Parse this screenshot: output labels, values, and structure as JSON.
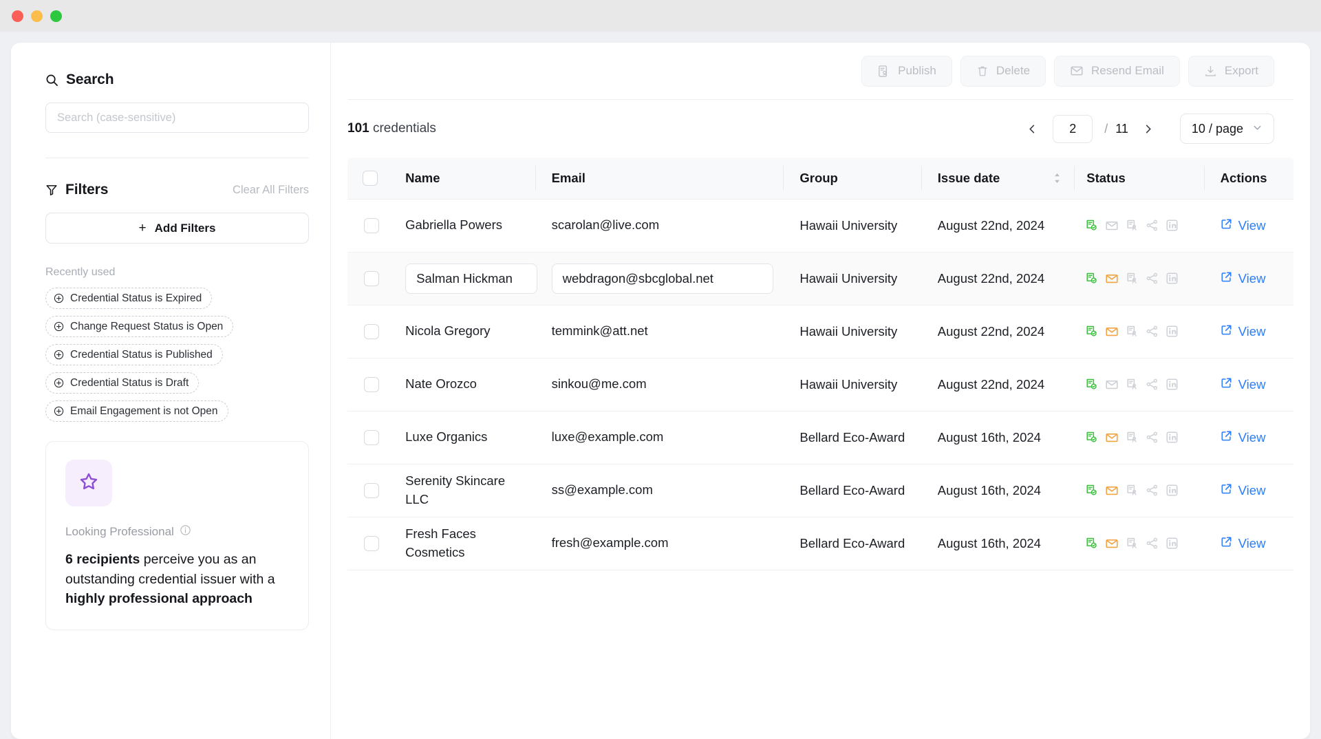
{
  "window": {
    "traffic_lights": [
      "close",
      "minimize",
      "maximize"
    ]
  },
  "sidebar": {
    "search": {
      "heading": "Search",
      "icon": "search-icon",
      "placeholder": "Search (case-sensitive)",
      "value": ""
    },
    "filters": {
      "heading": "Filters",
      "icon": "filter-icon",
      "clear_all_label": "Clear All Filters",
      "add_filters_label": "Add Filters",
      "add_filters_plus": "+",
      "recently_used_label": "Recently used",
      "recent_chips": [
        {
          "label": "Credential Status is Expired",
          "icon": "plus-circle-icon"
        },
        {
          "label": "Change Request Status is Open",
          "icon": "plus-circle-icon"
        },
        {
          "label": "Credential Status is Published",
          "icon": "plus-circle-icon"
        },
        {
          "label": "Credential Status is Draft",
          "icon": "plus-circle-icon"
        },
        {
          "label": "Email Engagement is not Open",
          "icon": "plus-circle-icon"
        }
      ]
    },
    "promo": {
      "icon": "star-icon",
      "icon_color": "#8b4dd6",
      "icon_bg": "#f6edfd",
      "title": "Looking Professional",
      "info_icon": "info-circle-icon",
      "body_parts": [
        {
          "text": "6 recipients",
          "bold": true
        },
        {
          "text": " perceive you as an outstanding credential issuer with a ",
          "bold": false
        },
        {
          "text": "highly professional approach",
          "bold": true
        }
      ]
    }
  },
  "toolbar": {
    "buttons": [
      {
        "label": "Publish",
        "icon": "publish-document-icon",
        "disabled": true
      },
      {
        "label": "Delete",
        "icon": "trash-icon",
        "disabled": true
      },
      {
        "label": "Resend Email",
        "icon": "envelope-icon",
        "disabled": true
      },
      {
        "label": "Export",
        "icon": "download-icon",
        "disabled": true
      }
    ]
  },
  "list_header": {
    "count": "101",
    "count_noun": "credentials",
    "pagination": {
      "prev_icon": "chevron-left-icon",
      "next_icon": "chevron-right-icon",
      "current_page": "2",
      "separator": "/",
      "total_pages": "11",
      "per_page_label": "10 / page",
      "per_page_caret": "chevron-down-icon"
    }
  },
  "table": {
    "select_all_checkbox": "unchecked",
    "columns": [
      {
        "label": "Name"
      },
      {
        "label": "Email"
      },
      {
        "label": "Group"
      },
      {
        "label": "Issue date",
        "sortable": true,
        "sort_icon": "sort-updown-icon"
      },
      {
        "label": "Status"
      },
      {
        "label": "Actions"
      }
    ],
    "rows": [
      {
        "checked": false,
        "editing": false,
        "active": false,
        "name": "Gabriella Powers",
        "email": "scarolan@live.com",
        "group": "Hawaii University",
        "issue_date": "August 22nd, 2024",
        "status_icons": [
          {
            "name": "credential-published-icon",
            "state": "active",
            "color": "#3dbd3d"
          },
          {
            "name": "email-sent-icon",
            "state": "inactive",
            "color": "#cdd1d6"
          },
          {
            "name": "credential-viewed-icon",
            "state": "inactive",
            "color": "#cdd1d6"
          },
          {
            "name": "share-icon",
            "state": "inactive",
            "color": "#cdd1d6"
          },
          {
            "name": "linkedin-icon",
            "state": "inactive",
            "color": "#cdd1d6"
          }
        ],
        "action_label": "View",
        "action_icon": "external-link-icon"
      },
      {
        "checked": false,
        "editing": true,
        "active": true,
        "name": "Salman Hickman",
        "email": "webdragon@sbcglobal.net",
        "group": "Hawaii University",
        "issue_date": "August 22nd, 2024",
        "status_icons": [
          {
            "name": "credential-published-icon",
            "state": "active",
            "color": "#3dbd3d"
          },
          {
            "name": "email-sent-icon",
            "state": "active",
            "color": "#f5a councillor"
          },
          {
            "name": "credential-viewed-icon",
            "state": "inactive",
            "color": "#cdd1d6"
          },
          {
            "name": "share-icon",
            "state": "inactive",
            "color": "#cdd1d6"
          },
          {
            "name": "linkedin-icon",
            "state": "inactive",
            "color": "#cdd1d6"
          }
        ],
        "action_label": "View",
        "action_icon": "external-link-icon"
      },
      {
        "checked": false,
        "editing": false,
        "active": false,
        "name": "Nicola Gregory",
        "email": "temmink@att.net",
        "group": "Hawaii University",
        "issue_date": "August 22nd, 2024",
        "status_icons": [
          {
            "name": "credential-published-icon",
            "state": "active",
            "color": "#3dbd3d"
          },
          {
            "name": "email-sent-icon",
            "state": "active",
            "color": "#f5a councillor"
          },
          {
            "name": "credential-viewed-icon",
            "state": "inactive",
            "color": "#cdd1d6"
          },
          {
            "name": "share-icon",
            "state": "inactive",
            "color": "#cdd1d6"
          },
          {
            "name": "linkedin-icon",
            "state": "inactive",
            "color": "#cdd1d6"
          }
        ],
        "action_label": "View",
        "action_icon": "external-link-icon"
      },
      {
        "checked": false,
        "editing": false,
        "active": false,
        "name": "Nate Orozco",
        "email": "sinkou@me.com",
        "group": "Hawaii University",
        "issue_date": "August 22nd, 2024",
        "status_icons": [
          {
            "name": "credential-published-icon",
            "state": "active",
            "color": "#3dbd3d"
          },
          {
            "name": "email-sent-icon",
            "state": "inactive",
            "color": "#cdd1d6"
          },
          {
            "name": "credential-viewed-icon",
            "state": "inactive",
            "color": "#cdd1d6"
          },
          {
            "name": "share-icon",
            "state": "inactive",
            "color": "#cdd1d6"
          },
          {
            "name": "linkedin-icon",
            "state": "inactive",
            "color": "#cdd1d6"
          }
        ],
        "action_label": "View",
        "action_icon": "external-link-icon"
      },
      {
        "checked": false,
        "editing": false,
        "active": false,
        "name": "Luxe Organics",
        "email": "luxe@example.com",
        "group": "Bellard Eco-Award",
        "issue_date": "August 16th, 2024",
        "status_icons": [
          {
            "name": "credential-published-icon",
            "state": "active",
            "color": "#3dbd3d"
          },
          {
            "name": "email-sent-icon",
            "state": "active",
            "color": "#f5a councillor"
          },
          {
            "name": "credential-viewed-icon",
            "state": "inactive",
            "color": "#cdd1d6"
          },
          {
            "name": "share-icon",
            "state": "inactive",
            "color": "#cdd1d6"
          },
          {
            "name": "linkedin-icon",
            "state": "inactive",
            "color": "#cdd1d6"
          }
        ],
        "action_label": "View",
        "action_icon": "external-link-icon"
      },
      {
        "checked": false,
        "editing": false,
        "active": false,
        "name": "Serenity Skincare\nLLC",
        "email": "ss@example.com",
        "group": "Bellard Eco-Award",
        "issue_date": "August 16th, 2024",
        "status_icons": [
          {
            "name": "credential-published-icon",
            "state": "active",
            "color": "#3dbd3d"
          },
          {
            "name": "email-sent-icon",
            "state": "active",
            "color": "#f5a councillor"
          },
          {
            "name": "credential-viewed-icon",
            "state": "inactive",
            "color": "#cdd1d6"
          },
          {
            "name": "share-icon",
            "state": "inactive",
            "color": "#cdd1d6"
          },
          {
            "name": "linkedin-icon",
            "state": "inactive",
            "color": "#cdd1d6"
          }
        ],
        "action_label": "View",
        "action_icon": "external-link-icon"
      },
      {
        "checked": false,
        "editing": false,
        "active": false,
        "name": "Fresh Faces\nCosmetics",
        "email": "fresh@example.com",
        "group": "Bellard Eco-Award",
        "issue_date": "August 16th, 2024",
        "status_icons": [
          {
            "name": "credential-published-icon",
            "state": "active",
            "color": "#3dbd3d"
          },
          {
            "name": "email-sent-icon",
            "state": "active",
            "color": "#f5a councillor"
          },
          {
            "name": "credential-viewed-icon",
            "state": "inactive",
            "color": "#cdd1d6"
          },
          {
            "name": "share-icon",
            "state": "inactive",
            "color": "#cdd1d6"
          },
          {
            "name": "linkedin-icon",
            "state": "inactive",
            "color": "#cdd1d6"
          }
        ],
        "action_label": "View",
        "action_icon": "external-link-icon"
      }
    ]
  },
  "colors": {
    "accent_link": "#2a7dff",
    "status_active_green": "#3dbd3d",
    "status_active_orange": "#f5a councillor",
    "status_inactive": "#cdd1d6",
    "promo_purple": "#8b4dd6"
  }
}
